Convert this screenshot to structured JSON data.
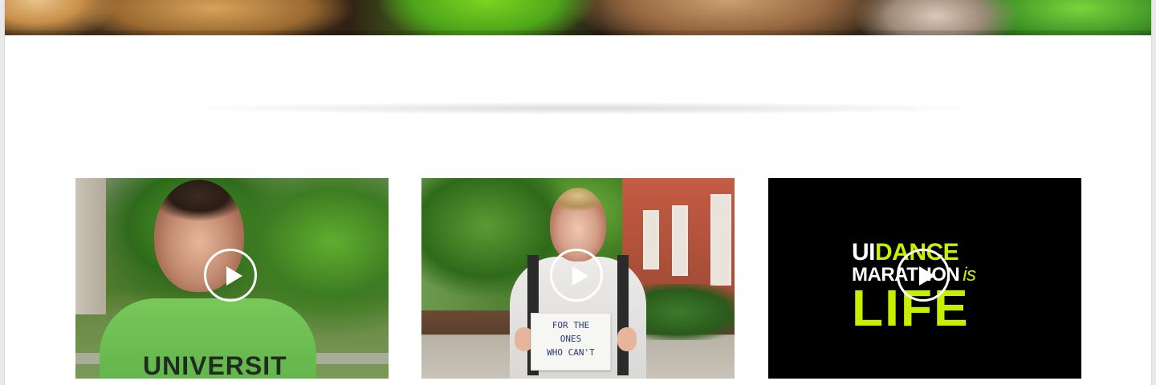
{
  "videos": [
    {
      "id": "video-1",
      "shirt_text": "UNIVERSIT",
      "play_icon": "play-icon"
    },
    {
      "id": "video-2",
      "sign_text": "FOR THE\nONES\nWHO CAN'T",
      "play_icon": "play-icon"
    },
    {
      "id": "video-3",
      "logo": {
        "ui": "UI",
        "dance": "DANCE",
        "marathon": "MARATHON",
        "is": "is",
        "life": "LIFE"
      },
      "play_icon": "play-icon"
    }
  ],
  "colors": {
    "accent_lime": "#c6f000",
    "page_bg": "#ffffff"
  }
}
